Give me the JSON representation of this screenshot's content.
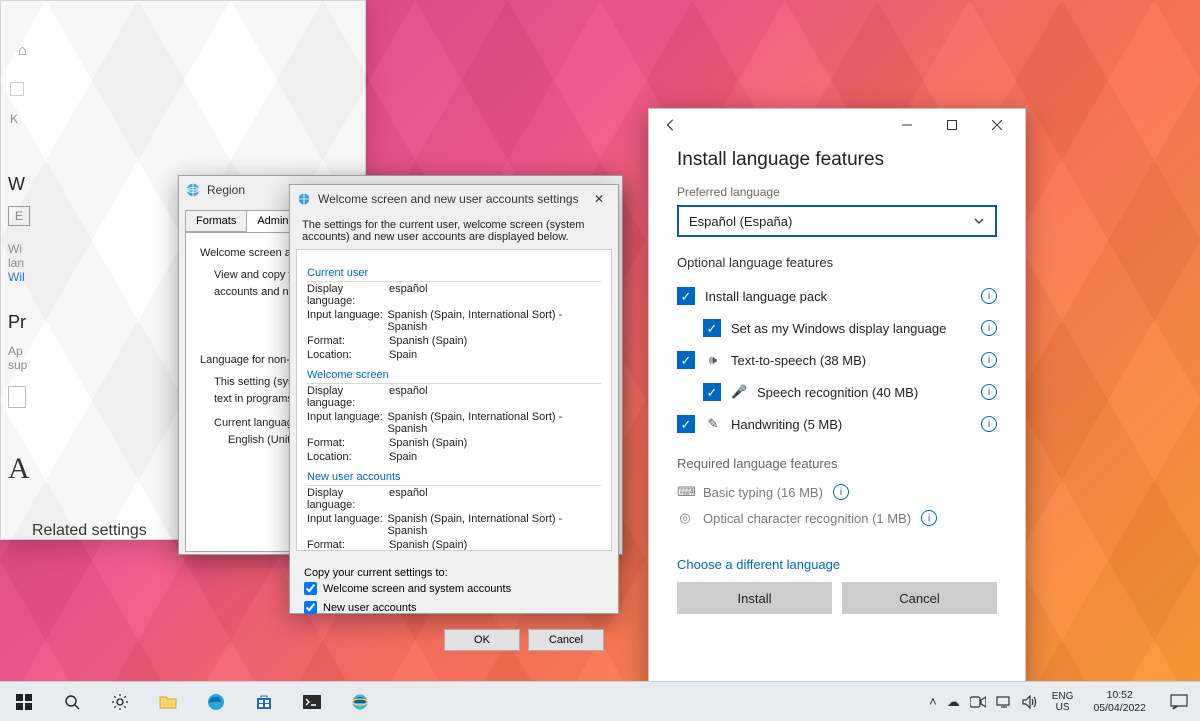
{
  "region": {
    "title": "Region",
    "tabs": {
      "formats": "Formats",
      "administrative": "Administrative"
    },
    "group1_title": "Welcome screen and new",
    "group1_body_l1": "View and copy your inte",
    "group1_body_l2": "accounts and new user a",
    "group2_title": "Language for non-Unicod",
    "group2_body_l1": "This setting (system loca",
    "group2_body_l2": "text in programs that do",
    "group2_body_l3": "Current language for no",
    "group2_body_l4": "English (United State"
  },
  "welcome": {
    "title": "Welcome screen and new user accounts settings",
    "intro": "The settings for the current user, welcome screen (system accounts) and new user accounts are displayed below.",
    "sections": {
      "current_user": "Current user",
      "welcome_screen": "Welcome screen",
      "new_user_accounts": "New user accounts"
    },
    "labels": {
      "display_language": "Display language:",
      "input_language": "Input language:",
      "format": "Format:",
      "location": "Location:"
    },
    "values": {
      "display_language": "español",
      "input_language": "Spanish (Spain, International Sort) - Spanish",
      "format": "Spanish (Spain)",
      "location": "Spain"
    },
    "copy_heading": "Copy your current settings to:",
    "chk_welcome": "Welcome screen and system accounts",
    "chk_newuser": "New user accounts",
    "ok": "OK",
    "cancel": "Cancel"
  },
  "lang_under": {
    "home_icon": "⌂",
    "letters": {
      "k": "K",
      "w": "W",
      "e": "E"
    },
    "wi1": "Wi",
    "lan": "lan",
    "wil": "Wil",
    "pr": "Pr",
    "ap": "Ap",
    "sup": "sup",
    "big_a": "A",
    "related": "Related settings"
  },
  "lang": {
    "heading": "Install language features",
    "pref_label": "Preferred language",
    "selected": "Español (España)",
    "optional_h": "Optional language features",
    "features": {
      "install_pack": "Install language pack",
      "set_display": "Set as my Windows display language",
      "tts": "Text-to-speech (38 MB)",
      "speech": "Speech recognition (40 MB)",
      "handwriting": "Handwriting (5 MB)"
    },
    "required_h": "Required language features",
    "required": {
      "basic_typing": "Basic typing (16 MB)",
      "ocr": "Optical character recognition (1 MB)"
    },
    "choose_link": "Choose a different language",
    "install": "Install",
    "cancel": "Cancel"
  },
  "taskbar": {
    "lang1": "ENG",
    "lang2": "US",
    "time": "10:52",
    "date": "05/04/2022"
  }
}
